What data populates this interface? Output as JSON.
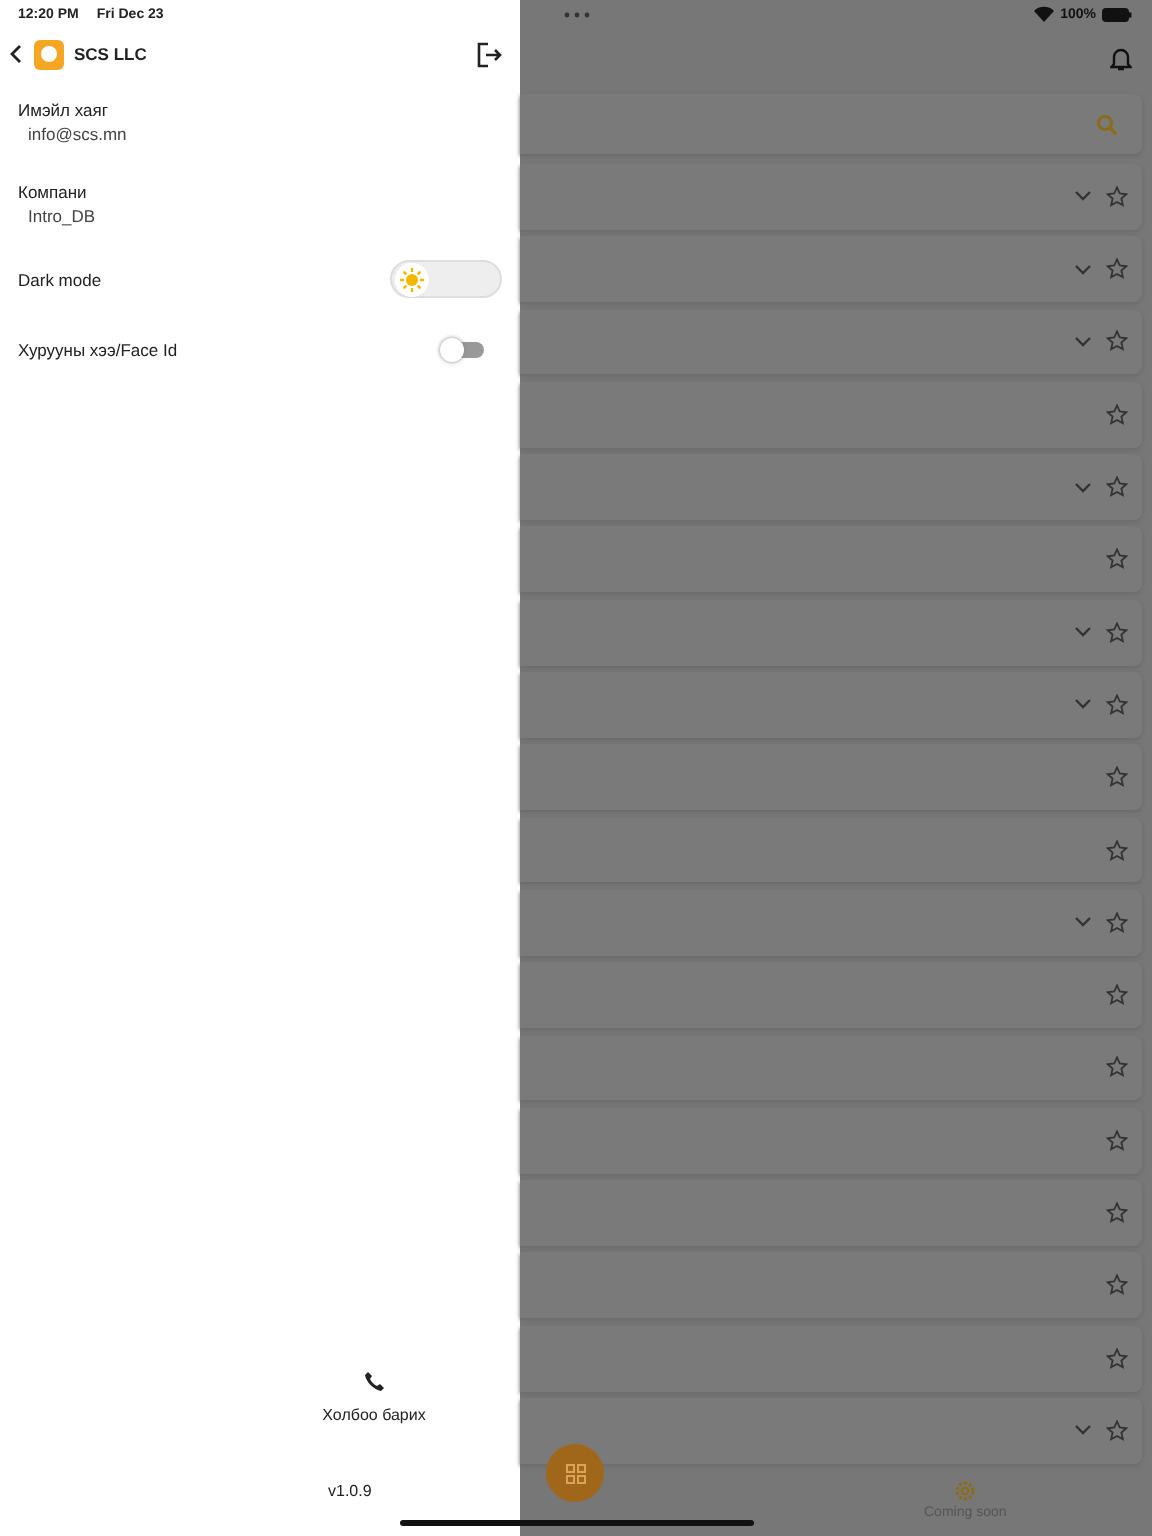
{
  "status_bar": {
    "time": "12:20 PM",
    "date": "Fri Dec 23",
    "battery": "100%"
  },
  "drawer": {
    "company_name": "SCS LLC",
    "fields": [
      {
        "label": "Имэйл хаяг",
        "value": "info@scs.mn"
      },
      {
        "label": "Компани",
        "value": "Intro_DB"
      }
    ],
    "settings": [
      {
        "kind": "theme",
        "label": "Dark mode",
        "on": false
      },
      {
        "kind": "switch",
        "label": "Хурууны хээ/Face Id",
        "on": false
      }
    ],
    "contact": "Холбоо барих",
    "version": "v1.0.9"
  },
  "list_rows": [
    {
      "expandable": true
    },
    {
      "expandable": true
    },
    {
      "expandable": true
    },
    {
      "expandable": false
    },
    {
      "expandable": true
    },
    {
      "expandable": false
    },
    {
      "expandable": true
    },
    {
      "expandable": true
    },
    {
      "expandable": false
    },
    {
      "expandable": false
    },
    {
      "expandable": true
    },
    {
      "expandable": false
    },
    {
      "expandable": false
    },
    {
      "expandable": false
    },
    {
      "expandable": false
    },
    {
      "expandable": false
    },
    {
      "expandable": false
    },
    {
      "expandable": true
    }
  ],
  "bottom_nav": {
    "coming_soon": "Coming soon"
  }
}
